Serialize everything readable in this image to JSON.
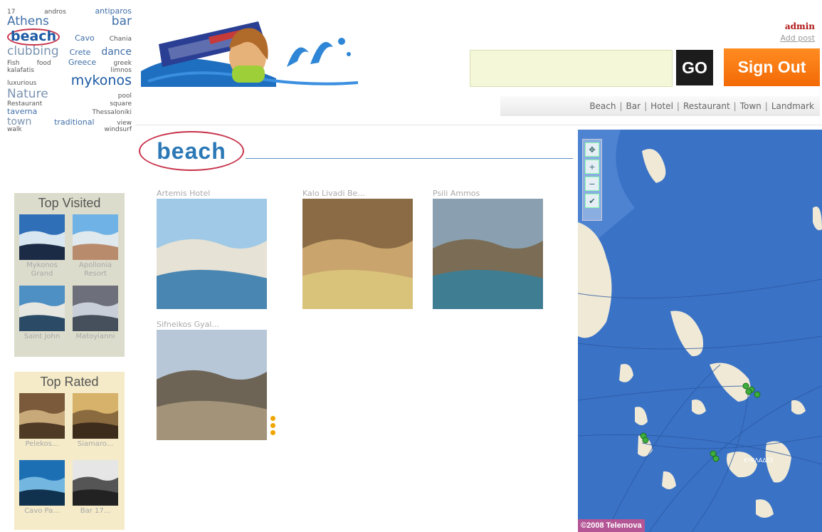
{
  "tagcloud": [
    [
      {
        "text": "17",
        "s": "t1"
      },
      {
        "text": "andros",
        "s": "t1"
      },
      {
        "text": "antiparos",
        "s": "t2"
      }
    ],
    [
      {
        "text": "Athens",
        "s": "t4"
      },
      {
        "text": "bar",
        "s": "t4"
      }
    ],
    [
      {
        "text": "beach",
        "s": "t5",
        "circled": true
      },
      {
        "text": "Cavo",
        "s": "t2"
      },
      {
        "text": "Chania",
        "s": "t1"
      }
    ],
    [
      {
        "text": "clubbing",
        "s": "t4",
        "light": true
      },
      {
        "text": "Crete",
        "s": "t2"
      },
      {
        "text": "dance",
        "s": "t3"
      }
    ],
    [
      {
        "text": "Fish",
        "s": "t1"
      },
      {
        "text": "food",
        "s": "t1"
      },
      {
        "text": "Greece",
        "s": "t2"
      },
      {
        "text": "greek",
        "s": "t1"
      }
    ],
    [
      {
        "text": "kalafatis",
        "s": "t1"
      },
      {
        "text": "limnos",
        "s": "t1"
      }
    ],
    [
      {
        "text": "luxurious",
        "s": "t1"
      },
      {
        "text": "mykonos",
        "s": "t5"
      }
    ],
    [
      {
        "text": "Nature",
        "s": "t4",
        "light": true
      },
      {
        "text": "pool",
        "s": "t1"
      }
    ],
    [
      {
        "text": "Restaurant",
        "s": "t1"
      },
      {
        "text": "square",
        "s": "t1"
      }
    ],
    [
      {
        "text": "taverna",
        "s": "t2"
      },
      {
        "text": "Thessaloniki",
        "s": "t1"
      }
    ],
    [
      {
        "text": "town",
        "s": "t3",
        "light": true
      },
      {
        "text": "traditional",
        "s": "t2"
      },
      {
        "text": "view",
        "s": "t1"
      }
    ],
    [
      {
        "text": "walk",
        "s": "t1"
      },
      {
        "text": "windsurf",
        "s": "t1"
      }
    ]
  ],
  "user": {
    "name": "admin",
    "add_post": "Add post"
  },
  "search": {
    "value": "",
    "go_label": "GO",
    "signout_label": "Sign Out"
  },
  "categories": [
    "Beach",
    "Bar",
    "Hotel",
    "Restaurant",
    "Town",
    "Landmark"
  ],
  "page": {
    "title": "beach"
  },
  "results": [
    {
      "title": "Artemis Hotel",
      "palette": [
        "#9fc9e6",
        "#e6e2d6",
        "#4a86b2"
      ]
    },
    {
      "title": "Kalo Livadi Be...",
      "palette": [
        "#8a6b45",
        "#c9a56d",
        "#d9c27a"
      ]
    },
    {
      "title": "Psili Ammos",
      "palette": [
        "#8aa0b0",
        "#7b6d55",
        "#3f7d93"
      ]
    },
    {
      "title": "Sifneikos Gyal...",
      "palette": [
        "#b7c7d7",
        "#6d6456",
        "#a39379"
      ]
    }
  ],
  "top_visited": {
    "title": "Top Visited",
    "items": [
      {
        "caption": "Mykonos Grand",
        "palette": [
          "#2f6fb8",
          "#d8e6f1",
          "#1b2a45"
        ]
      },
      {
        "caption": "Apollonia Resort",
        "palette": [
          "#6fb2e6",
          "#dfe9ee",
          "#b98b6d"
        ]
      },
      {
        "caption": "Saint John",
        "palette": [
          "#4e8fc4",
          "#e7e7e1",
          "#2a4a66"
        ]
      },
      {
        "caption": "Matoyianni",
        "palette": [
          "#6d6f7a",
          "#c9cfd9",
          "#46505c"
        ]
      }
    ]
  },
  "top_rated": {
    "title": "Top Rated",
    "items": [
      {
        "caption": "Pelekos...",
        "palette": [
          "#7a5a3a",
          "#c8aa7a",
          "#4f3a25"
        ]
      },
      {
        "caption": "Siamaro...",
        "palette": [
          "#d6b26a",
          "#8a6a3f",
          "#3d2b1b"
        ]
      },
      {
        "caption": "Cavo Pa...",
        "palette": [
          "#1d6fb4",
          "#73b7e0",
          "#11324f"
        ]
      },
      {
        "caption": "Bar 17...",
        "palette": [
          "#e6e6e6",
          "#555555",
          "#222222"
        ]
      }
    ]
  },
  "map": {
    "copyright": "©2008 Telemova",
    "city_label": "ΚΥΚΛΑΔΕΣ"
  },
  "colors": {
    "accent_blue": "#2b78b6",
    "signout_orange": "#f47a10",
    "tag_blue": "#3f6ea8",
    "map_sea": "#3a72c6"
  }
}
